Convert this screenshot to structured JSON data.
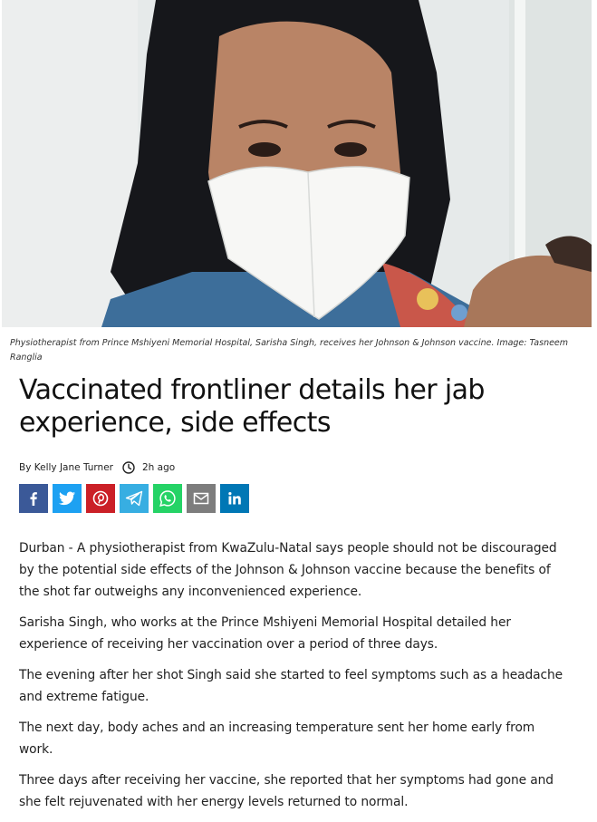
{
  "image_caption": "Physiotherapist from Prince Mshiyeni Memorial Hospital, Sarisha Singh, receives her Johnson & Johnson vaccine. Image: Tasneem Ranglia",
  "headline": "Vaccinated frontliner details her jab experience, side effects",
  "byline": {
    "author": "By Kelly Jane Turner",
    "time_ago": "2h ago"
  },
  "share_buttons": [
    {
      "icon": "facebook-icon",
      "color": "#3b5998"
    },
    {
      "icon": "twitter-icon",
      "color": "#1da1f2"
    },
    {
      "icon": "pinterest-icon",
      "color": "#cb2027"
    },
    {
      "icon": "telegram-icon",
      "color": "#37aee2"
    },
    {
      "icon": "whatsapp-icon",
      "color": "#25d366"
    },
    {
      "icon": "email-icon",
      "color": "#7d7d7d"
    },
    {
      "icon": "linkedin-icon",
      "color": "#0077b5"
    }
  ],
  "paragraphs": [
    "Durban - A physiotherapist from KwaZulu-Natal says people should not be discouraged by the potential side effects of the Johnson & Johnson vaccine because the benefits of the shot far outweighs any inconvenienced experience.",
    "Sarisha Singh, who works at the Prince Mshiyeni Memorial Hospital detailed her experience of receiving her vaccination over a period of three days.",
    "The evening after her shot Singh said she started to feel symptoms such as a headache and extreme fatigue.",
    "The next day, body aches and an increasing temperature sent her home early from work.",
    "Three days after receiving her vaccine, she reported that her symptoms had gone and she felt rejuvenated with her energy levels returned to normal."
  ]
}
